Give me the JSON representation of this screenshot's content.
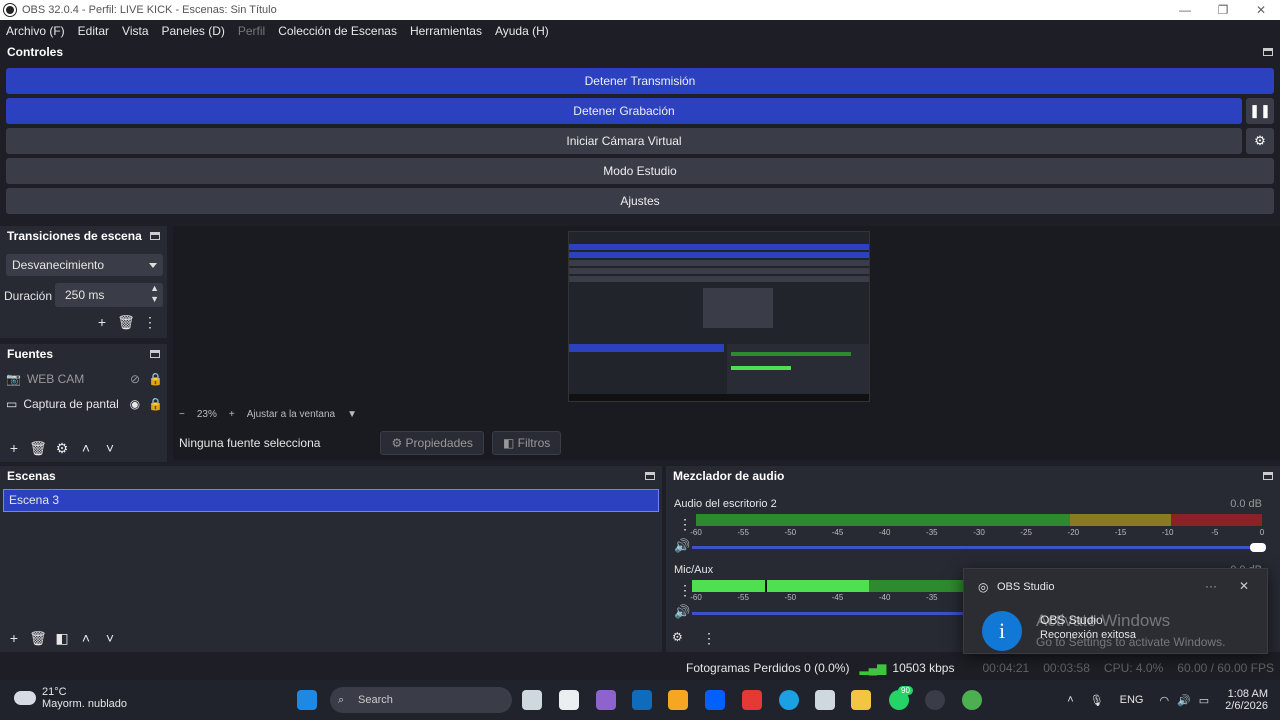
{
  "window": {
    "title": "OBS 32.0.4 - Perfil: LIVE KICK - Escenas: Sin Título",
    "controls": [
      "—",
      "❐",
      "✕"
    ]
  },
  "menu": {
    "items": [
      "Archivo (F)",
      "Editar",
      "Vista",
      "Paneles (D)",
      "Perfil",
      "Colección de Escenas",
      "Herramientas",
      "Ayuda (H)"
    ],
    "disabled_index": 4
  },
  "controls": {
    "title": "Controles",
    "stop_stream": "Detener Transmisión",
    "stop_recording": "Detener Grabación",
    "virtual_cam": "Iniciar Cámara Virtual",
    "studio_mode": "Modo Estudio",
    "settings": "Ajustes"
  },
  "transitions": {
    "title": "Transiciones de escena",
    "selected": "Desvanecimiento",
    "duration_label": "Duración",
    "duration_value": "250 ms"
  },
  "sources": {
    "title": "Fuentes",
    "items": [
      {
        "name": "WEB CAM",
        "visible": false
      },
      {
        "name": "Captura de pantal",
        "visible": true
      }
    ]
  },
  "preview": {
    "zoom": "23%",
    "fit_label": "Ajustar a la ventana",
    "no_source": "Ninguna fuente selecciona",
    "properties": "Propiedades",
    "filters": "Filtros"
  },
  "scenes": {
    "title": "Escenas",
    "items": [
      "Escena 3"
    ]
  },
  "mixer": {
    "title": "Mezclador de audio",
    "channels": [
      {
        "name": "Audio del escritorio 2",
        "db": "0.0 dB"
      },
      {
        "name": "Mic/Aux",
        "db": "0.0 dB"
      }
    ],
    "ticks": [
      "-60",
      "-55",
      "-50",
      "-45",
      "-40",
      "-35",
      "-30",
      "-25",
      "-20",
      "-15",
      "-10",
      "-5",
      "0"
    ]
  },
  "status": {
    "dropped": "Fotogramas Perdidos 0 (0.0%)",
    "bitrate": "10503 kbps",
    "stream_time": "00:04:21",
    "rec_time": "00:03:58",
    "cpu": "CPU: 4.0%",
    "fps": "60.00 / 60.00 FPS"
  },
  "toast": {
    "app": "OBS Studio",
    "title": "OBS Studio",
    "message": "Reconexión exitosa"
  },
  "watermark": {
    "line1": "Activate Windows",
    "line2": "Go to Settings to activate Windows."
  },
  "taskbar": {
    "temp": "21°C",
    "weather": "Mayorm. nublado",
    "search": "Search",
    "whatsapp_badge": "90",
    "lang": "ENG",
    "time": "1:08 AM",
    "date": "2/6/2026"
  },
  "colors": {
    "accent": "#2c41c0",
    "panel": "#272a33",
    "background": "#1e1f26",
    "button": "#3a3d47"
  }
}
